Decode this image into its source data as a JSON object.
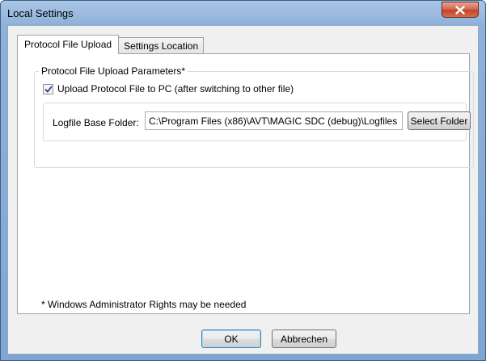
{
  "window": {
    "title": "Local Settings"
  },
  "tabs": [
    {
      "label": "Protocol File Upload",
      "active": true
    },
    {
      "label": "Settings Location",
      "active": false
    }
  ],
  "upload_params": {
    "group_label": "Protocol File Upload Parameters*",
    "checkbox_label": "Upload Protocol File to PC (after switching to other file)",
    "checkbox_checked": true,
    "folder_label": "Logfile Base Folder:",
    "folder_value": "C:\\Program Files (x86)\\AVT\\MAGIC SDC (debug)\\Logfiles",
    "select_folder_label": "Select Folder"
  },
  "footnote": "* Windows Administrator Rights may be needed",
  "buttons": {
    "ok_label": "OK",
    "cancel_label": "Abbrechen"
  },
  "icons": {
    "close": "close-icon",
    "check": "checkmark-icon"
  },
  "colors": {
    "title_bar": "#8fb1d9",
    "close_button": "#c4442a",
    "dialog_bg": "#f0f0f0",
    "checkmark": "#1f3f8c"
  }
}
